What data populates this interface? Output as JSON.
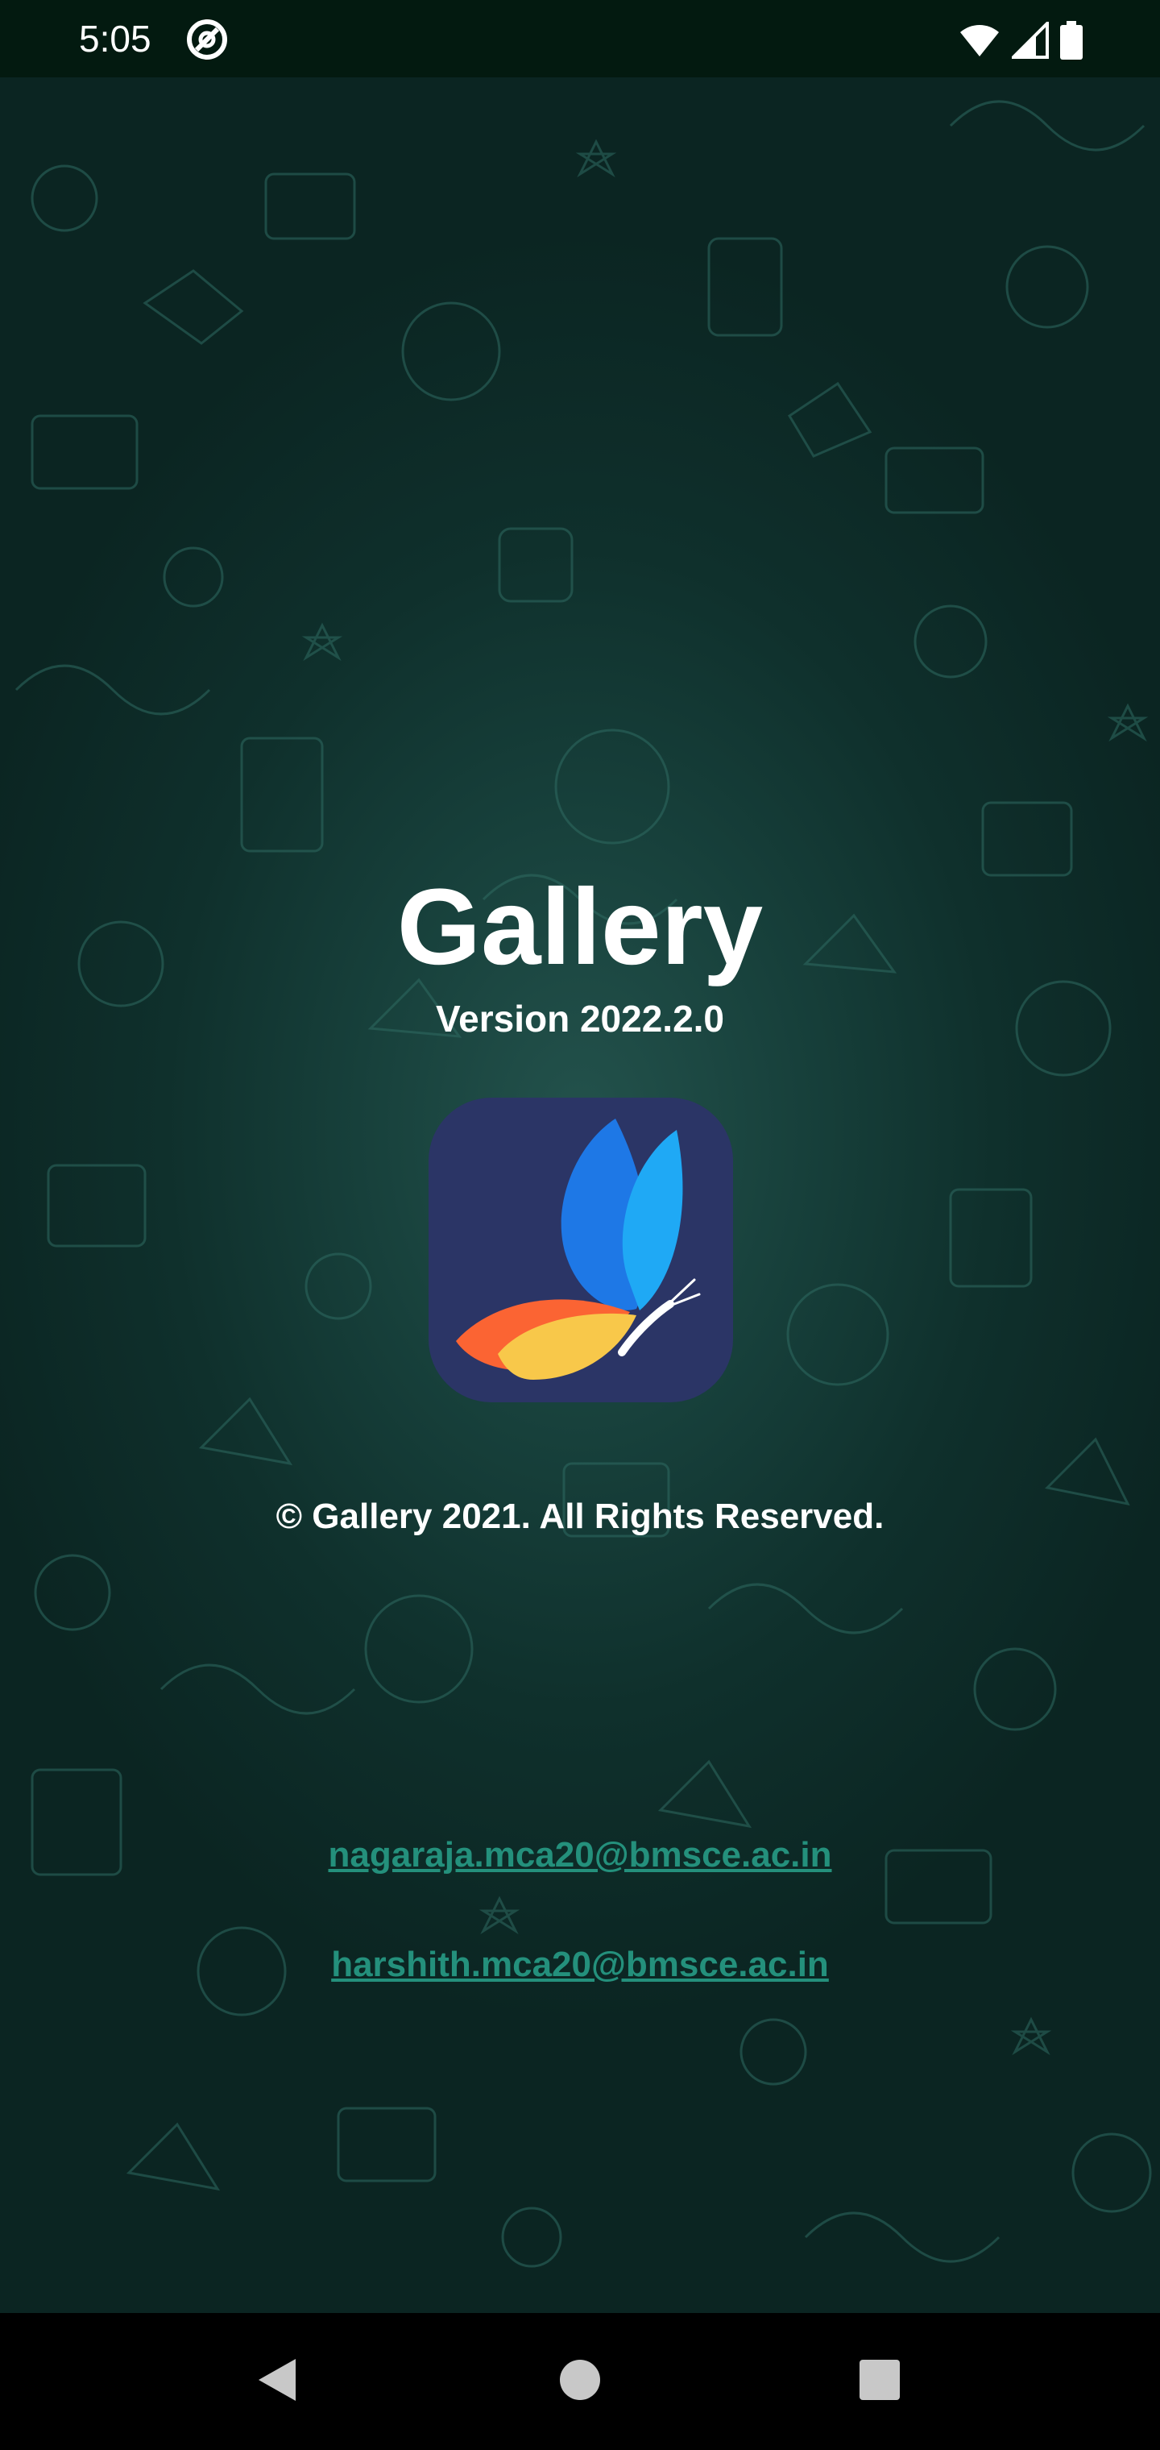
{
  "status_bar": {
    "time": "5:05",
    "app_icon": "at-sign-notification-icon",
    "icons": [
      "wifi-icon",
      "cellular-signal-icon",
      "battery-icon"
    ]
  },
  "about": {
    "title": "Gallery",
    "version": "Version 2022.2.0",
    "logo_icon": "butterfly-logo-icon",
    "copyright": "© Gallery 2021. All Rights Reserved.",
    "emails": [
      "nagaraja.mca20@bmsce.ac.in",
      "harshith.mca20@bmsce.ac.in"
    ]
  },
  "nav_bar": {
    "icons": [
      "back-icon",
      "home-icon",
      "recents-icon"
    ]
  },
  "colors": {
    "status_bar_bg": "#031a10",
    "background_center": "#23524c",
    "background_edge": "#0b2522",
    "link": "#24907c",
    "logo_bg": "#2b3566",
    "nav_bg": "#000000"
  }
}
